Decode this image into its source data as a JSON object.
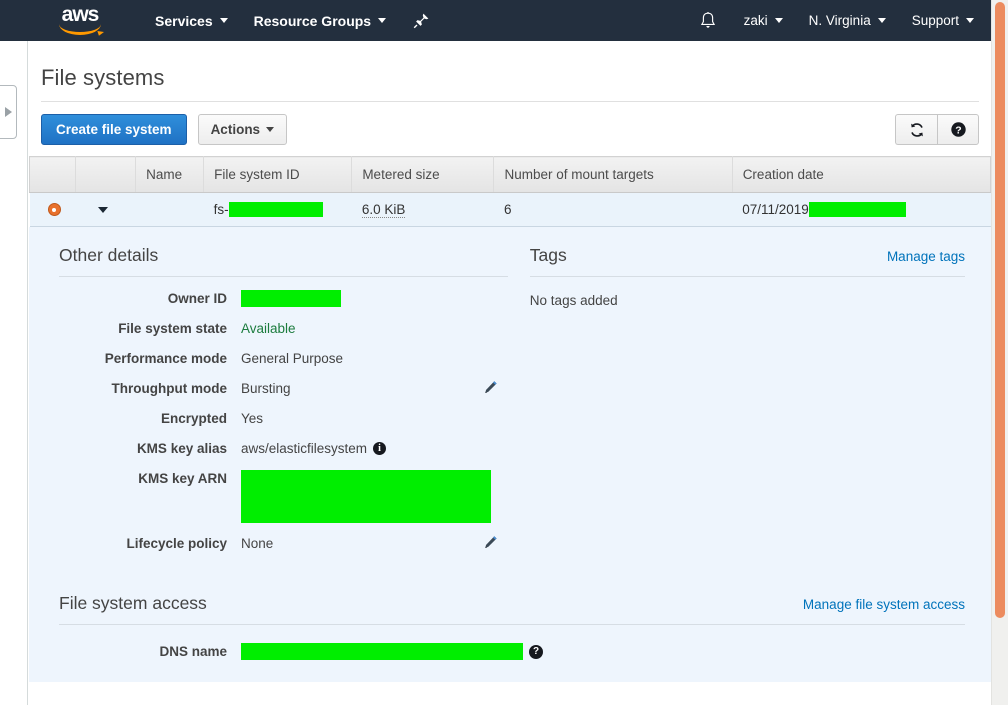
{
  "navbar": {
    "logo_text": "aws",
    "services_label": "Services",
    "resource_groups_label": "Resource Groups",
    "pin_icon": "pushpin-icon",
    "bell_icon": "bell-icon",
    "account_label": "zaki",
    "region_label": "N. Virginia",
    "support_label": "Support"
  },
  "sidebar": {
    "expand_icon": "triangle-right-icon"
  },
  "page": {
    "title": "File systems"
  },
  "toolbar": {
    "create_label": "Create file system",
    "actions_label": "Actions",
    "refresh_icon": "refresh-icon",
    "help_icon": "help-circle-icon"
  },
  "table": {
    "columns": [
      "",
      "",
      "Name",
      "File system ID",
      "Metered size",
      "Number of mount targets",
      "Creation date"
    ],
    "row": {
      "selected": true,
      "expanded": true,
      "name": "",
      "file_system_id_prefix": "fs-",
      "file_system_id_redacted": true,
      "metered_size": "6.0 KiB",
      "mount_targets": "6",
      "creation_date": "07/11/2019",
      "creation_time_redacted": true
    }
  },
  "other_details": {
    "title": "Other details",
    "rows": [
      {
        "label": "Owner ID",
        "value": "",
        "redacted": true,
        "pencil": false,
        "info": false,
        "green": false
      },
      {
        "label": "File system state",
        "value": "Available",
        "redacted": false,
        "pencil": false,
        "info": false,
        "green": true
      },
      {
        "label": "Performance mode",
        "value": "General Purpose",
        "redacted": false,
        "pencil": false,
        "info": false,
        "green": false
      },
      {
        "label": "Throughput mode",
        "value": "Bursting",
        "redacted": false,
        "pencil": true,
        "info": false,
        "green": false
      },
      {
        "label": "Encrypted",
        "value": "Yes",
        "redacted": false,
        "pencil": false,
        "info": false,
        "green": false
      },
      {
        "label": "KMS key alias",
        "value": "aws/elasticfilesystem",
        "redacted": false,
        "pencil": false,
        "info": true,
        "green": false
      },
      {
        "label": "KMS key ARN",
        "value": "",
        "redacted": true,
        "pencil": false,
        "info": false,
        "green": false
      },
      {
        "label": "Lifecycle policy",
        "value": "None",
        "redacted": false,
        "pencil": true,
        "info": false,
        "green": false
      }
    ]
  },
  "tags": {
    "title": "Tags",
    "manage_link": "Manage tags",
    "empty_text": "No tags added"
  },
  "file_system_access": {
    "title": "File system access",
    "manage_link": "Manage file system access",
    "dns_label": "DNS name",
    "dns_value": "",
    "dns_redacted": true
  },
  "colors": {
    "nav_bg": "#232f3e",
    "logo_orange": "#ff9900",
    "primary_button": "#1f72c4",
    "link": "#0073bb",
    "available_green": "#1c7c3e",
    "redaction_green": "#00ee00",
    "selected_row": "#eaf3fb",
    "detail_bg": "#eef5fd",
    "radio_orange": "#e8712d",
    "scrollbar_thumb": "#ec8b5e"
  }
}
